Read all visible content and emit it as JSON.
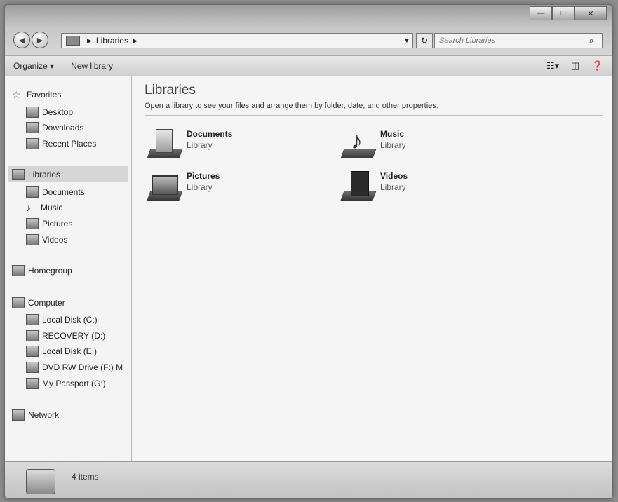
{
  "window": {
    "caption_buttons": [
      "—",
      "□",
      "✕"
    ]
  },
  "address": {
    "path": [
      "Libraries"
    ],
    "refresh_glyph": "↻"
  },
  "search": {
    "placeholder": "Search Libraries"
  },
  "toolbar": {
    "organize_label": "Organize ▾",
    "new_library_label": "New library",
    "icons": [
      "view-options-icon",
      "preview-pane-icon",
      "help-icon"
    ]
  },
  "nav": {
    "favorites": {
      "label": "Favorites",
      "items": [
        "Desktop",
        "Downloads",
        "Recent Places"
      ]
    },
    "libraries": {
      "label": "Libraries",
      "items": [
        "Documents",
        "Music",
        "Pictures",
        "Videos"
      ]
    },
    "homegroup": {
      "label": "Homegroup"
    },
    "computer": {
      "label": "Computer",
      "items": [
        "Local Disk (C:)",
        "RECOVERY (D:)",
        "Local Disk (E:)",
        "DVD RW Drive (F:) M",
        "My Passport (G:)"
      ]
    },
    "network": {
      "label": "Network"
    }
  },
  "content": {
    "title": "Libraries",
    "subtitle": "Open a library to see your files and arrange them by folder, date, and other properties.",
    "libraries": [
      {
        "name": "Documents",
        "kind": "Library",
        "icon": "documents-library-icon"
      },
      {
        "name": "Music",
        "kind": "Library",
        "icon": "music-library-icon"
      },
      {
        "name": "Pictures",
        "kind": "Library",
        "icon": "pictures-library-icon"
      },
      {
        "name": "Videos",
        "kind": "Library",
        "icon": "videos-library-icon"
      }
    ]
  },
  "status": {
    "text": "4 items"
  }
}
